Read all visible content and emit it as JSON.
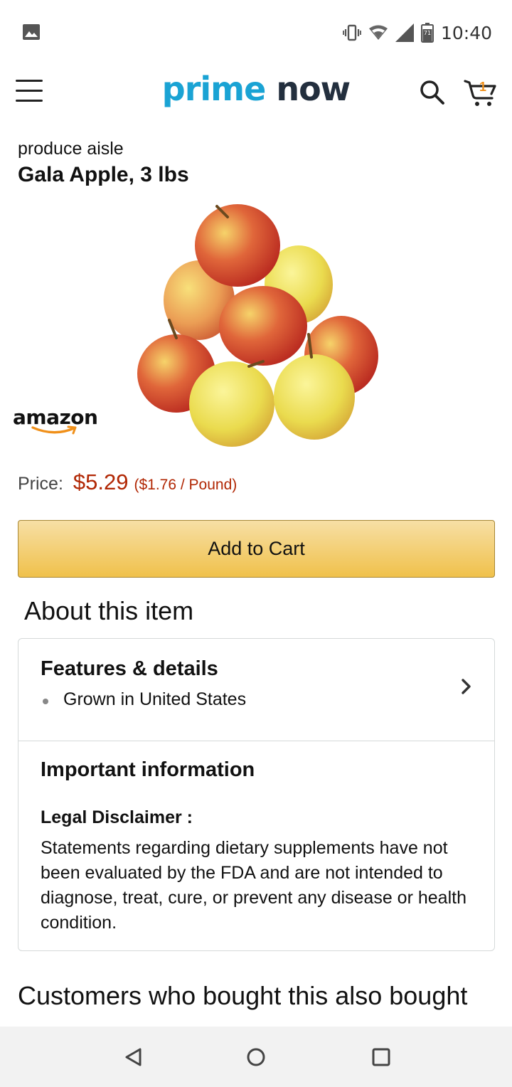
{
  "status_bar": {
    "time": "10:40",
    "battery_level": "71",
    "icons": [
      "image-icon",
      "vibrate-icon",
      "wifi-icon",
      "cell-signal-icon",
      "battery-icon"
    ]
  },
  "app_bar": {
    "logo_prime": "prime",
    "logo_now": "now",
    "cart_count": "1",
    "icons": [
      "menu-icon",
      "search-icon",
      "cart-icon"
    ]
  },
  "product": {
    "aisle": "produce aisle",
    "title": "Gala Apple, 3 lbs",
    "brand_logo_text": "amazon",
    "price_label": "Price:",
    "price": "$5.29",
    "unit_price": "($1.76 / Pound)",
    "add_to_cart": "Add to Cart"
  },
  "about": {
    "heading": "About this item",
    "features_title": "Features & details",
    "features_bullets": [
      "Grown in United States"
    ],
    "important_title": "Important information",
    "legal_label": "Legal Disclaimer :",
    "legal_text": "Statements regarding dietary supplements have not been evaluated by the FDA and are not intended to diagnose, treat, cure, or prevent any disease or health condition."
  },
  "also_bought": {
    "heading": "Customers who bought this also bought"
  },
  "colors": {
    "prime_blue": "#1aa3d4",
    "navy": "#232f3e",
    "price_red": "#b12704",
    "button_yellow": "#f0c14b",
    "cart_orange": "#f0901a"
  }
}
